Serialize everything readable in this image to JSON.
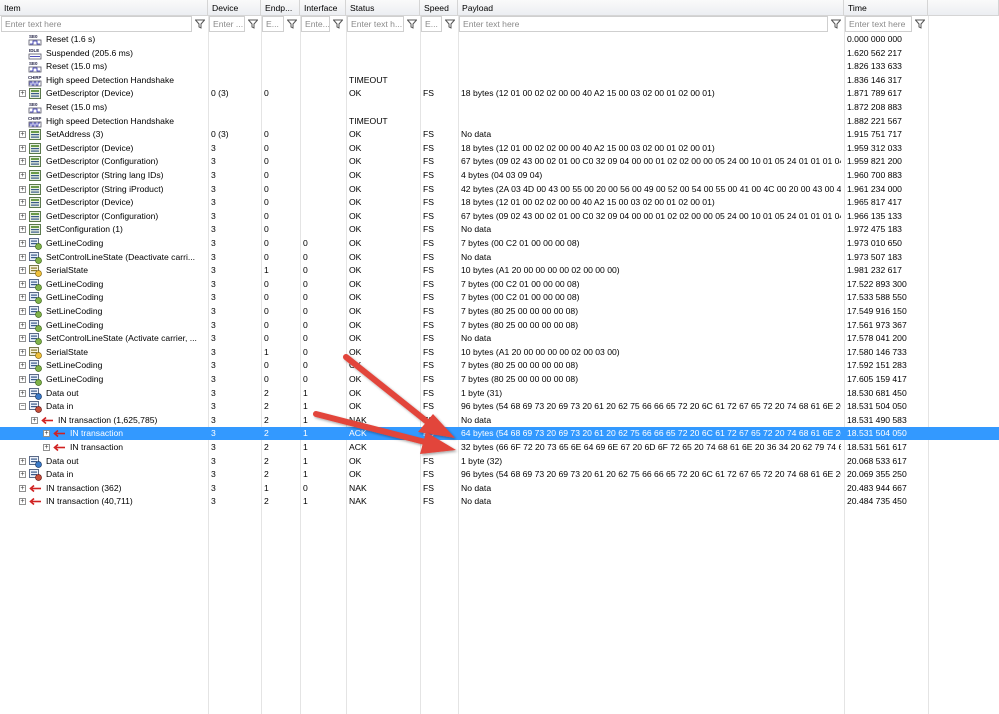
{
  "columns": [
    {
      "key": "item",
      "label": "Item",
      "placeholder": "Enter text here"
    },
    {
      "key": "device",
      "label": "Device",
      "placeholder": "Enter ..."
    },
    {
      "key": "endpoint",
      "label": "Endp...",
      "placeholder": "E..."
    },
    {
      "key": "interface",
      "label": "Interface",
      "placeholder": "Ente..."
    },
    {
      "key": "status",
      "label": "Status",
      "placeholder": "Enter text h..."
    },
    {
      "key": "speed",
      "label": "Speed",
      "placeholder": "E..."
    },
    {
      "key": "payload",
      "label": "Payload",
      "placeholder": "Enter text here"
    },
    {
      "key": "time",
      "label": "Time",
      "placeholder": "Enter text here"
    }
  ],
  "rows": [
    {
      "indent": 0,
      "expander": "",
      "icon": "reset-icon",
      "item": "Reset (1.6 s)",
      "device": "",
      "endpoint": "",
      "interface": "",
      "status": "",
      "speed": "",
      "payload": "",
      "time": "0.000 000 000"
    },
    {
      "indent": 0,
      "expander": "",
      "icon": "idle-icon",
      "item": "Suspended (205.6 ms)",
      "device": "",
      "endpoint": "",
      "interface": "",
      "status": "",
      "speed": "",
      "payload": "",
      "time": "1.620 562 217"
    },
    {
      "indent": 0,
      "expander": "",
      "icon": "reset-icon",
      "item": "Reset (15.0 ms)",
      "device": "",
      "endpoint": "",
      "interface": "",
      "status": "",
      "speed": "",
      "payload": "",
      "time": "1.826 133 633"
    },
    {
      "indent": 0,
      "expander": "",
      "icon": "chirp-icon",
      "item": "High speed Detection Handshake",
      "device": "",
      "endpoint": "",
      "interface": "",
      "status": "TIMEOUT",
      "speed": "",
      "payload": "",
      "time": "1.836 146 317"
    },
    {
      "indent": 0,
      "expander": "+",
      "icon": "control-transfer-icon",
      "item": "GetDescriptor (Device)",
      "device": "0 (3)",
      "endpoint": "0",
      "interface": "",
      "status": "OK",
      "speed": "FS",
      "payload": "18 bytes (12 01 00 02 02 00 00 40 A2 15 00 03 02 00 01 02 00 01)",
      "time": "1.871 789 617"
    },
    {
      "indent": 0,
      "expander": "",
      "icon": "reset-icon",
      "item": "Reset (15.0 ms)",
      "device": "",
      "endpoint": "",
      "interface": "",
      "status": "",
      "speed": "",
      "payload": "",
      "time": "1.872 208 883"
    },
    {
      "indent": 0,
      "expander": "",
      "icon": "chirp-icon",
      "item": "High speed Detection Handshake",
      "device": "",
      "endpoint": "",
      "interface": "",
      "status": "TIMEOUT",
      "speed": "",
      "payload": "",
      "time": "1.882 221 567"
    },
    {
      "indent": 0,
      "expander": "+",
      "icon": "control-transfer-icon",
      "item": "SetAddress (3)",
      "device": "0 (3)",
      "endpoint": "0",
      "interface": "",
      "status": "OK",
      "speed": "FS",
      "payload": "No data",
      "time": "1.915 751 717"
    },
    {
      "indent": 0,
      "expander": "+",
      "icon": "control-transfer-icon",
      "item": "GetDescriptor (Device)",
      "device": "3",
      "endpoint": "0",
      "interface": "",
      "status": "OK",
      "speed": "FS",
      "payload": "18 bytes (12 01 00 02 02 00 00 40 A2 15 00 03 02 00 01 02 00 01)",
      "time": "1.959 312 033"
    },
    {
      "indent": 0,
      "expander": "+",
      "icon": "control-transfer-icon",
      "item": "GetDescriptor (Configuration)",
      "device": "3",
      "endpoint": "0",
      "interface": "",
      "status": "OK",
      "speed": "FS",
      "payload": "67 bytes (09 02 43 00 02 01 00 C0 32 09 04 00 00 01 02 02 00 00 05 24 00 10 01 05 24 01 01 01 04 ...",
      "time": "1.959 821 200"
    },
    {
      "indent": 0,
      "expander": "+",
      "icon": "control-transfer-icon",
      "item": "GetDescriptor (String lang IDs)",
      "device": "3",
      "endpoint": "0",
      "interface": "",
      "status": "OK",
      "speed": "FS",
      "payload": "4 bytes (04 03 09 04)",
      "time": "1.960 700 883"
    },
    {
      "indent": 0,
      "expander": "+",
      "icon": "control-transfer-icon",
      "item": "GetDescriptor (String iProduct)",
      "device": "3",
      "endpoint": "0",
      "interface": "",
      "status": "OK",
      "speed": "FS",
      "payload": "42 bytes (2A 03 4D 00 43 00 55 00 20 00 56 00 49 00 52 00 54 00 55 00 41 00 4C 00 20 00 43 00 4 ...",
      "time": "1.961 234 000"
    },
    {
      "indent": 0,
      "expander": "+",
      "icon": "control-transfer-icon",
      "item": "GetDescriptor (Device)",
      "device": "3",
      "endpoint": "0",
      "interface": "",
      "status": "OK",
      "speed": "FS",
      "payload": "18 bytes (12 01 00 02 02 00 00 40 A2 15 00 03 02 00 01 02 00 01)",
      "time": "1.965 817 417"
    },
    {
      "indent": 0,
      "expander": "+",
      "icon": "control-transfer-icon",
      "item": "GetDescriptor (Configuration)",
      "device": "3",
      "endpoint": "0",
      "interface": "",
      "status": "OK",
      "speed": "FS",
      "payload": "67 bytes (09 02 43 00 02 01 00 C0 32 09 04 00 00 01 02 02 00 00 05 24 00 10 01 05 24 01 01 01 04 ...",
      "time": "1.966 135 133"
    },
    {
      "indent": 0,
      "expander": "+",
      "icon": "control-transfer-icon",
      "item": "SetConfiguration (1)",
      "device": "3",
      "endpoint": "0",
      "interface": "",
      "status": "OK",
      "speed": "FS",
      "payload": "No data",
      "time": "1.972 475 183"
    },
    {
      "indent": 0,
      "expander": "+",
      "icon": "class-request-icon",
      "item": "GetLineCoding",
      "device": "3",
      "endpoint": "0",
      "interface": "0",
      "status": "OK",
      "speed": "FS",
      "payload": "7 bytes (00 C2 01 00 00 00 08)",
      "time": "1.973 010 650"
    },
    {
      "indent": 0,
      "expander": "+",
      "icon": "class-request-icon",
      "item": "SetControlLineState (Deactivate carri...",
      "device": "3",
      "endpoint": "0",
      "interface": "0",
      "status": "OK",
      "speed": "FS",
      "payload": "No data",
      "time": "1.973 507 183"
    },
    {
      "indent": 0,
      "expander": "+",
      "icon": "serial-state-icon",
      "item": "SerialState",
      "device": "3",
      "endpoint": "1",
      "interface": "0",
      "status": "OK",
      "speed": "FS",
      "payload": "10 bytes (A1 20 00 00 00 00 02 00 00 00)",
      "time": "1.981 232 617"
    },
    {
      "indent": 0,
      "expander": "+",
      "icon": "class-request-icon",
      "item": "GetLineCoding",
      "device": "3",
      "endpoint": "0",
      "interface": "0",
      "status": "OK",
      "speed": "FS",
      "payload": "7 bytes (00 C2 01 00 00 00 08)",
      "time": "17.522 893 300"
    },
    {
      "indent": 0,
      "expander": "+",
      "icon": "class-request-icon",
      "item": "GetLineCoding",
      "device": "3",
      "endpoint": "0",
      "interface": "0",
      "status": "OK",
      "speed": "FS",
      "payload": "7 bytes (00 C2 01 00 00 00 08)",
      "time": "17.533 588 550"
    },
    {
      "indent": 0,
      "expander": "+",
      "icon": "class-request-icon",
      "item": "SetLineCoding",
      "device": "3",
      "endpoint": "0",
      "interface": "0",
      "status": "OK",
      "speed": "FS",
      "payload": "7 bytes (80 25 00 00 00 00 08)",
      "time": "17.549 916 150"
    },
    {
      "indent": 0,
      "expander": "+",
      "icon": "class-request-icon",
      "item": "GetLineCoding",
      "device": "3",
      "endpoint": "0",
      "interface": "0",
      "status": "OK",
      "speed": "FS",
      "payload": "7 bytes (80 25 00 00 00 00 08)",
      "time": "17.561 973 367"
    },
    {
      "indent": 0,
      "expander": "+",
      "icon": "class-request-icon",
      "item": "SetControlLineState (Activate carrier, ...",
      "device": "3",
      "endpoint": "0",
      "interface": "0",
      "status": "OK",
      "speed": "FS",
      "payload": "No data",
      "time": "17.578 041 200"
    },
    {
      "indent": 0,
      "expander": "+",
      "icon": "serial-state-icon",
      "item": "SerialState",
      "device": "3",
      "endpoint": "1",
      "interface": "0",
      "status": "OK",
      "speed": "FS",
      "payload": "10 bytes (A1 20 00 00 00 00 02 00 03 00)",
      "time": "17.580 146 733"
    },
    {
      "indent": 0,
      "expander": "+",
      "icon": "class-request-icon",
      "item": "SetLineCoding",
      "device": "3",
      "endpoint": "0",
      "interface": "0",
      "status": "OK",
      "speed": "FS",
      "payload": "7 bytes (80 25 00 00 00 00 08)",
      "time": "17.592 151 283"
    },
    {
      "indent": 0,
      "expander": "+",
      "icon": "class-request-icon",
      "item": "GetLineCoding",
      "device": "3",
      "endpoint": "0",
      "interface": "0",
      "status": "OK",
      "speed": "FS",
      "payload": "7 bytes (80 25 00 00 00 00 08)",
      "time": "17.605 159 417"
    },
    {
      "indent": 0,
      "expander": "+",
      "icon": "data-out-icon",
      "item": "Data out",
      "device": "3",
      "endpoint": "2",
      "interface": "1",
      "status": "OK",
      "speed": "FS",
      "payload": "1 byte (31)",
      "time": "18.530 681 450"
    },
    {
      "indent": 0,
      "expander": "−",
      "icon": "data-in-icon",
      "item": "Data in",
      "device": "3",
      "endpoint": "2",
      "interface": "1",
      "status": "OK",
      "speed": "FS",
      "payload": "96 bytes (54 68 69 73 20 69 73 20 61 20 62 75 66 66 65 72 20 6C 61 72 67 65 72 20 74 68 61 6E 20 ...",
      "time": "18.531 504 050"
    },
    {
      "indent": 1,
      "expander": "+",
      "icon": "in-transaction-icon",
      "item": "IN transaction (1,625,785)",
      "device": "3",
      "endpoint": "2",
      "interface": "1",
      "status": "NAK",
      "speed": "FS",
      "payload": "No data",
      "time": "18.531 490 583"
    },
    {
      "indent": 2,
      "expander": "+",
      "icon": "in-transaction-icon",
      "item": "IN transaction",
      "device": "3",
      "endpoint": "2",
      "interface": "1",
      "status": "ACK",
      "speed": "FS",
      "payload": "64 bytes (54 68 69 73 20 69 73 20 61 20 62 75 66 66 65 72 20 6C 61 72 67 65 72 20 74 68 61 6E 20 ...",
      "time": "18.531 504 050",
      "selected": true
    },
    {
      "indent": 2,
      "expander": "+",
      "icon": "in-transaction-icon",
      "item": "IN transaction",
      "device": "3",
      "endpoint": "2",
      "interface": "1",
      "status": "ACK",
      "speed": "FS",
      "payload": "32 bytes (66 6F 72 20 73 65 6E 64 69 6E 67 20 6D 6F 72 65 20 74 68 61 6E 20 36 34 20 62 79 74 65 ...",
      "time": "18.531 561 617"
    },
    {
      "indent": 0,
      "expander": "+",
      "icon": "data-out-icon",
      "item": "Data out",
      "device": "3",
      "endpoint": "2",
      "interface": "1",
      "status": "OK",
      "speed": "FS",
      "payload": "1 byte (32)",
      "time": "20.068 533 617"
    },
    {
      "indent": 0,
      "expander": "+",
      "icon": "data-in-icon",
      "item": "Data in",
      "device": "3",
      "endpoint": "2",
      "interface": "1",
      "status": "OK",
      "speed": "FS",
      "payload": "96 bytes (54 68 69 73 20 69 73 20 61 20 62 75 66 66 65 72 20 6C 61 72 67 65 72 20 74 68 61 6E 20 ...",
      "time": "20.069 355 250"
    },
    {
      "indent": 0,
      "expander": "+",
      "icon": "in-transaction-icon",
      "item": "IN transaction (362)",
      "device": "3",
      "endpoint": "1",
      "interface": "0",
      "status": "NAK",
      "speed": "FS",
      "payload": "No data",
      "time": "20.483 944 667"
    },
    {
      "indent": 0,
      "expander": "+",
      "icon": "in-transaction-icon",
      "item": "IN transaction (40,711)",
      "device": "3",
      "endpoint": "2",
      "interface": "1",
      "status": "NAK",
      "speed": "FS",
      "payload": "No data",
      "time": "20.484 735 450"
    }
  ],
  "colors": {
    "selection": "#3399ff",
    "annotation_arrow": "#e2453a"
  }
}
